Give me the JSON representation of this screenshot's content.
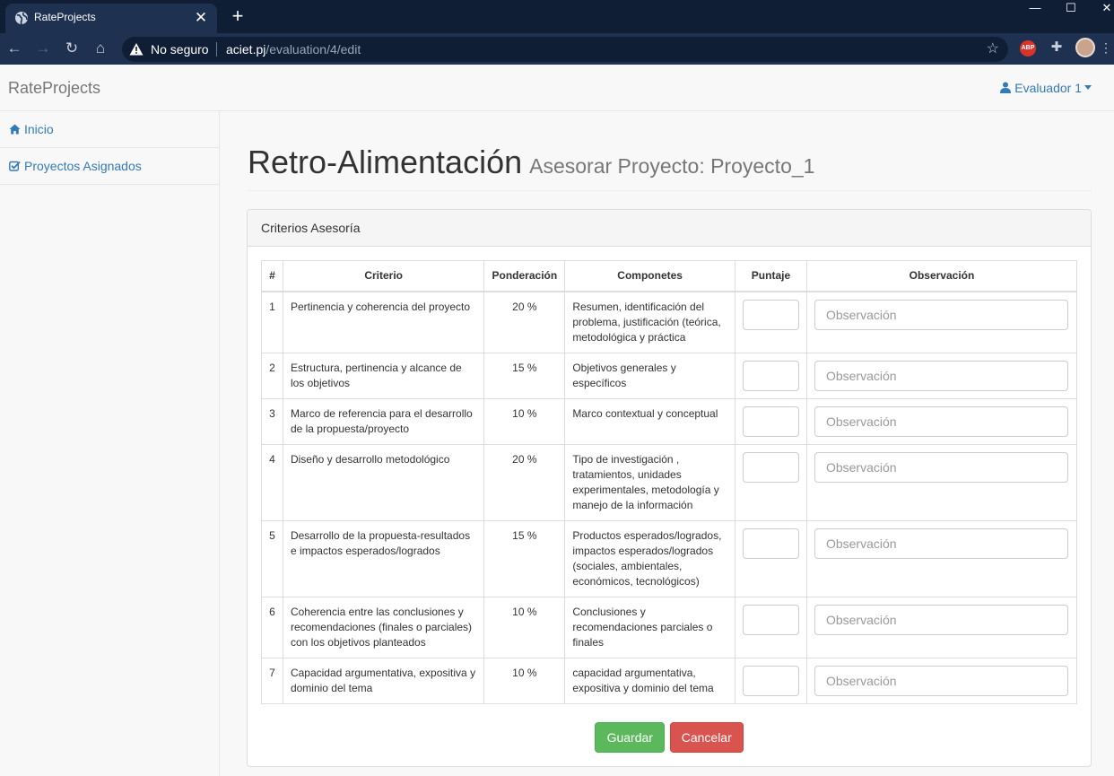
{
  "browser": {
    "tab_title": "RateProjects",
    "tab_close": "✕",
    "new_tab": "+",
    "security_label": "No seguro",
    "url_host": "aciet.pj",
    "url_path": "/evaluation/4/edit",
    "extension_abp": "ABP"
  },
  "navbar": {
    "brand": "RateProjects",
    "user_label": "Evaluador 1"
  },
  "sidebar": {
    "items": [
      {
        "label": "Inicio",
        "icon": "home-icon"
      },
      {
        "label": "Proyectos Asignados",
        "icon": "check-square-icon"
      }
    ]
  },
  "header": {
    "title": "Retro-Alimentación",
    "subtitle": "Asesorar Proyecto: Proyecto_1"
  },
  "panel": {
    "heading": "Criterios Asesoría"
  },
  "table": {
    "columns": [
      "#",
      "Criterio",
      "Ponderación",
      "Componetes",
      "Puntaje",
      "Observación"
    ],
    "observation_placeholder": "Observación",
    "rows": [
      {
        "num": "1",
        "criterio": "Pertinencia y coherencia del proyecto",
        "ponderacion": "20 %",
        "componentes": "Resumen, identificación del problema, justificación (teórica, metodológica y práctica"
      },
      {
        "num": "2",
        "criterio": "Estructura, pertinencia y alcance de los objetivos",
        "ponderacion": "15 %",
        "componentes": "Objetivos generales y específicos"
      },
      {
        "num": "3",
        "criterio": "Marco de referencia para el desarrollo de la propuesta/proyecto",
        "ponderacion": "10 %",
        "componentes": "Marco contextual y conceptual"
      },
      {
        "num": "4",
        "criterio": "Diseño y desarrollo metodológico",
        "ponderacion": "20 %",
        "componentes": "Tipo de investigación , tratamientos, unidades experimentales, metodología y manejo de la información"
      },
      {
        "num": "5",
        "criterio": "Desarrollo de la propuesta-resultados e impactos esperados/logrados",
        "ponderacion": "15 %",
        "componentes": "Productos esperados/logrados, impactos esperados/logrados (sociales, ambientales, económicos, tecnológicos)"
      },
      {
        "num": "6",
        "criterio": "Coherencia entre las conclusiones y recomendaciones (finales o parciales) con los objetivos planteados",
        "ponderacion": "10 %",
        "componentes": "Conclusiones y recomendaciones parciales o finales"
      },
      {
        "num": "7",
        "criterio": "Capacidad argumentativa, expositiva y dominio del tema",
        "ponderacion": "10 %",
        "componentes": "capacidad argumentativa, expositiva y dominio del tema"
      }
    ]
  },
  "actions": {
    "save_label": "Guardar",
    "cancel_label": "Cancelar"
  },
  "colors": {
    "link": "#337ab7",
    "success": "#5cb85c",
    "danger": "#d9534f"
  }
}
